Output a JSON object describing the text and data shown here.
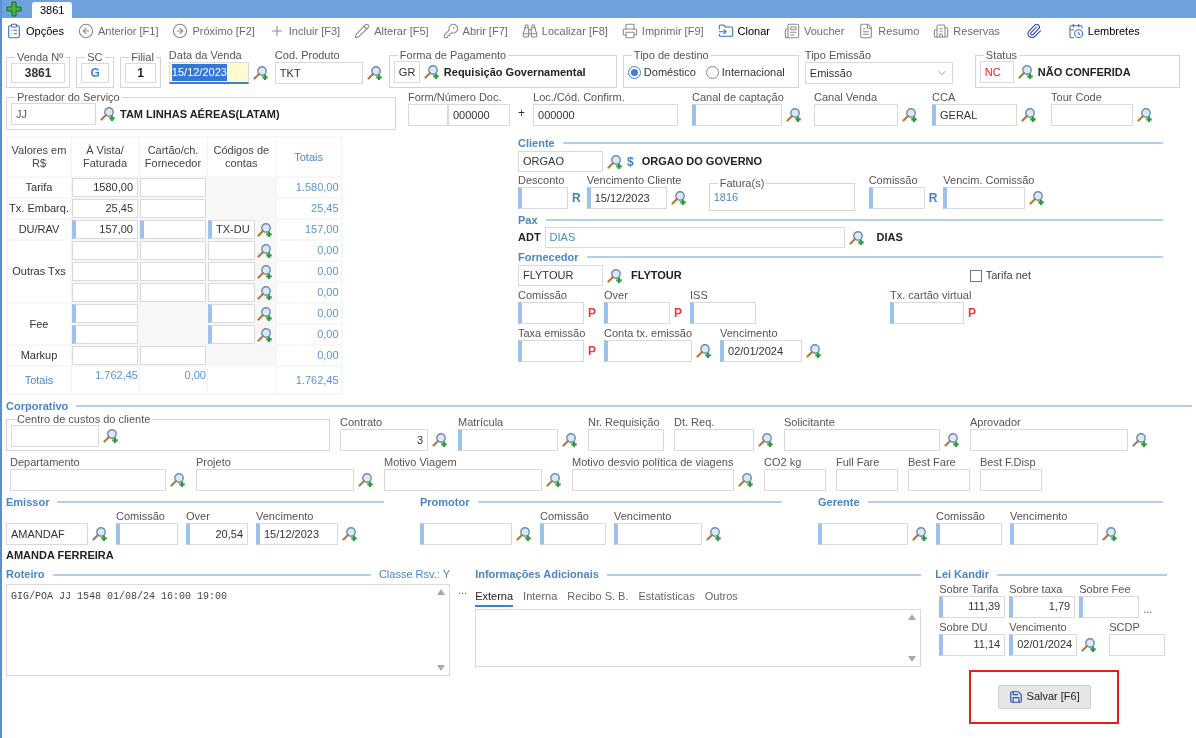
{
  "tab_bar": {
    "tab": "3861"
  },
  "toolbar": [
    {
      "label": "Opções",
      "kind": "button",
      "disabled": false
    },
    {
      "label": "Anterior [F1]",
      "kind": "button",
      "disabled": true
    },
    {
      "label": "Próximo [F2]",
      "kind": "button",
      "disabled": true
    },
    {
      "label": "Incluir [F3]",
      "kind": "button",
      "disabled": true
    },
    {
      "label": "Alterar [F5]",
      "kind": "button",
      "disabled": true
    },
    {
      "label": "Abrir [F7]",
      "kind": "button",
      "disabled": true
    },
    {
      "label": "Localizar [F8]",
      "kind": "button",
      "disabled": true
    },
    {
      "label": "Imprimir [F9]",
      "kind": "button",
      "disabled": true
    },
    {
      "label": "Clonar",
      "kind": "button",
      "disabled": false
    },
    {
      "label": "Voucher",
      "kind": "button",
      "disabled": true
    },
    {
      "label": "Resumo",
      "kind": "button",
      "disabled": true
    },
    {
      "label": "Reservas",
      "kind": "button",
      "disabled": true
    },
    {
      "kind": "icon",
      "disabled": false
    },
    {
      "label": "Lembretes",
      "kind": "button",
      "disabled": false
    }
  ],
  "header": {
    "venda": {
      "label": "Venda Nº",
      "value": "3861"
    },
    "sc": {
      "label": "SC",
      "value": "G"
    },
    "filial": {
      "label": "Filial",
      "value": "1"
    },
    "data_venda": {
      "label": "Data da Venda",
      "value": "15/12/2023",
      "focused": true,
      "marked": false,
      "lookup": true
    },
    "cod_produto": {
      "label": "Cod. Produto",
      "value": "TKT",
      "marked": false,
      "lookup": true
    },
    "forma_pagamento": {
      "label": "Forma de Pagamento",
      "code": "GR",
      "name": "Requisição Governamental"
    },
    "tipo_destino": {
      "label": "Tipo de destino",
      "options": [
        {
          "label": "Doméstico",
          "selected": true
        },
        {
          "label": "Internacional",
          "selected": false
        }
      ]
    },
    "tipo_emissao": {
      "label": "Tipo Emissão",
      "value": "Emissão"
    },
    "status": {
      "label": "Status",
      "code": "NC",
      "name": "NÃO CONFERIDA"
    },
    "prestador": {
      "label": "Prestador do Serviço",
      "code": "JJ",
      "name": "TAM LINHAS AÉREAS(LATAM)"
    },
    "form_numero": {
      "label": "Form/Número Doc.",
      "fields": [
        {
          "marked": false,
          "lookup": false
        },
        {
          "value": "000000",
          "marked": false,
          "lookup": false
        }
      ],
      "joiner": "+"
    },
    "loc_confirm": {
      "label": "Loc./Cód. Confirm.",
      "value": "000000",
      "marked": false,
      "lookup": false
    },
    "canal_captacao": {
      "label": "Canal de captação",
      "marked": true,
      "lookup": true
    },
    "canal_venda": {
      "label": "Canal Venda",
      "marked": false,
      "lookup": true
    },
    "cca": {
      "label": "CCA",
      "value": "GERAL",
      "marked": true,
      "lookup": true
    },
    "tour_code": {
      "label": "Tour Code",
      "marked": false,
      "lookup": true
    }
  },
  "values_table": {
    "columns": [
      "Valores em R$",
      "À Vista/ Faturada",
      "Cartão/ch. Fornecedor",
      "Códigos de contas"
    ],
    "totals_header": "Totais",
    "groups": [
      {
        "label": "Tarifa",
        "lines": [
          {
            "vista": {
              "value": "1580,00",
              "marked": false
            },
            "cartao": {
              "marked": false
            },
            "total": "1.580,00"
          }
        ]
      },
      {
        "label": "Tx. Embarq.",
        "lines": [
          {
            "vista": {
              "value": "25,45",
              "marked": false
            },
            "cartao": {
              "marked": false
            },
            "total": "25,45"
          }
        ]
      },
      {
        "label": "DU/RAV",
        "lines": [
          {
            "vista": {
              "value": "157,00",
              "marked": true
            },
            "cartao": {
              "marked": true
            },
            "codigo": {
              "value": "TX-DU",
              "marked": true
            },
            "total": "157,00"
          }
        ]
      },
      {
        "label": "Outras Txs",
        "lines": [
          {
            "vista": {
              "marked": false
            },
            "cartao": {
              "marked": false
            },
            "codigo": {
              "marked": false
            },
            "total": "0,00"
          },
          {
            "vista": {
              "marked": false
            },
            "cartao": {
              "marked": false
            },
            "codigo": {
              "marked": false
            },
            "total": "0,00"
          },
          {
            "vista": {
              "marked": false
            },
            "cartao": {
              "marked": false
            },
            "codigo": {
              "marked": false
            },
            "total": "0,00"
          }
        ]
      },
      {
        "label": "Fee",
        "lines": [
          {
            "vista": {
              "marked": true
            },
            "codigo": {
              "marked": true
            },
            "total": "0,00"
          },
          {
            "vista": {
              "marked": true
            },
            "codigo": {
              "marked": true
            },
            "total": "0,00"
          }
        ]
      },
      {
        "label": "Markup",
        "lines": [
          {
            "vista": {
              "marked": false
            },
            "cartao": {
              "marked": false
            },
            "total": "0,00"
          }
        ]
      }
    ],
    "totals": {
      "label": "Totais",
      "vista": "1.762,45",
      "cartao": "0,00",
      "total": "1.762,45"
    }
  },
  "cliente": {
    "title": "Cliente",
    "code": "ORGAO",
    "symbol": "$",
    "name": "ORGAO DO GOVERNO",
    "desconto": {
      "label": "Desconto",
      "marked": true,
      "lookup": false,
      "suffix": "R",
      "color": "#3b82d6"
    },
    "vencimento": {
      "label": "Vencimento Cliente",
      "value": "15/12/2023",
      "marked": true,
      "lookup": true
    },
    "faturas": {
      "label": "Fatura(s)",
      "value": "1816"
    },
    "comissao": {
      "label": "Comissão",
      "marked": true,
      "lookup": false,
      "suffix": "R",
      "color": "#3b82d6"
    },
    "vencim_comissao": {
      "label": "Vencim. Comissão",
      "marked": true,
      "lookup": true
    }
  },
  "pax": {
    "title": "Pax",
    "type": "ADT",
    "value": "DIAS",
    "name": "DIAS"
  },
  "fornecedor": {
    "title": "Fornecedor",
    "code": "FLYTOUR",
    "name": "FLYTOUR",
    "tarifa_net": {
      "label": "Tarifa net",
      "checked": false
    },
    "comissao": {
      "label": "Comissão",
      "marked": true,
      "lookup": false,
      "suffix": "P",
      "color": "#f03a3a"
    },
    "over": {
      "label": "Over",
      "marked": true,
      "lookup": false,
      "suffix": "P",
      "color": "#f03a3a"
    },
    "iss": {
      "label": "ISS",
      "marked": true,
      "lookup": false
    },
    "tx_cartao": {
      "label": "Tx. cartão virtual",
      "marked": true,
      "lookup": false,
      "suffix": "P",
      "color": "#f03a3a"
    },
    "taxa_emissao": {
      "label": "Taxa emissão",
      "marked": true,
      "lookup": false,
      "suffix": "P",
      "color": "#f03a3a"
    },
    "conta_tx": {
      "label": "Conta tx. emissão",
      "marked": true,
      "lookup": true
    },
    "vencimento": {
      "label": "Vencimento",
      "value": "02/01/2024",
      "marked": true,
      "lookup": true
    }
  },
  "corporativo": {
    "title": "Corporativo",
    "centro_custos": {
      "label": "Centro de custos do cliente",
      "marked": false,
      "lookup": true
    },
    "contrato": {
      "label": "Contrato",
      "value": "3",
      "marked": false,
      "lookup": true
    },
    "matricula": {
      "label": "Matrícula",
      "marked": true,
      "lookup": true
    },
    "nr_requisicao": {
      "label": "Nr. Requisição",
      "marked": false,
      "lookup": false
    },
    "dt_req": {
      "label": "Dt. Req.",
      "marked": false,
      "lookup": true
    },
    "solicitante": {
      "label": "Solicitante",
      "marked": false,
      "lookup": true
    },
    "aprovador": {
      "label": "Aprovador",
      "marked": false,
      "lookup": true
    },
    "departamento": {
      "label": "Departamento",
      "marked": false,
      "lookup": true
    },
    "projeto": {
      "label": "Projeto",
      "marked": false,
      "lookup": true
    },
    "motivo_viagem": {
      "label": "Motivo Viagem",
      "marked": false,
      "lookup": true
    },
    "motivo_desvio": {
      "label": "Motivo desvio política de viagens",
      "marked": false,
      "lookup": true
    },
    "co2": {
      "label": "CO2 kg",
      "marked": false,
      "lookup": false
    },
    "full_fare": {
      "label": "Full Fare",
      "marked": false,
      "lookup": false
    },
    "best_fare": {
      "label": "Best Fare",
      "marked": false,
      "lookup": false
    },
    "best_fdisp": {
      "label": "Best F.Disp",
      "marked": false,
      "lookup": false
    }
  },
  "emissor": {
    "title": "Emissor",
    "code": {
      "value": "AMANDAF",
      "marked": false,
      "lookup": true
    },
    "comissao": {
      "label": "Comissão",
      "marked": true,
      "lookup": false
    },
    "over": {
      "label": "Over",
      "value": "20,54",
      "marked": true,
      "lookup": false
    },
    "vencimento": {
      "label": "Vencimento",
      "value": "15/12/2023",
      "marked": true,
      "lookup": true
    },
    "name": "AMANDA FERREIRA"
  },
  "promotor": {
    "title": "Promotor",
    "code": {
      "marked": true,
      "lookup": true
    },
    "comissao": {
      "label": "Comissão",
      "marked": true,
      "lookup": false
    },
    "vencimento": {
      "label": "Vencimento",
      "marked": true,
      "lookup": true
    }
  },
  "gerente": {
    "title": "Gerente",
    "code": {
      "marked": true,
      "lookup": true
    },
    "comissao": {
      "label": "Comissão",
      "marked": true,
      "lookup": false
    },
    "vencimento": {
      "label": "Vencimento",
      "marked": true,
      "lookup": true
    }
  },
  "roteiro": {
    "title": "Roteiro",
    "classe": "Classe Rsv.: Y",
    "text": "GIG/POA JJ 1548 01/08/24 16:00 19:00",
    "more": "..."
  },
  "info": {
    "title": "Informações Adicionais",
    "tabs": [
      {
        "label": "Externa",
        "selected": true
      },
      {
        "label": "Interna",
        "selected": false
      },
      {
        "label": "Recibo S. B.",
        "selected": false
      },
      {
        "label": "Estatísticas",
        "selected": false
      },
      {
        "label": "Outros",
        "selected": false
      }
    ]
  },
  "lei_kandir": {
    "title": "Lei Kandir",
    "sobre_tarifa": {
      "label": "Sobre Tarifa",
      "value": "111,39",
      "marked": true,
      "lookup": false
    },
    "sobre_taxa": {
      "label": "Sobre taxa",
      "value": "1,79",
      "marked": true,
      "lookup": false
    },
    "sobre_fee": {
      "label": "Sobre Fee",
      "marked": true,
      "lookup": false
    },
    "more": "...",
    "sobre_du": {
      "label": "Sobre DU",
      "value": "11,14",
      "marked": true,
      "lookup": false
    },
    "vencimento": {
      "label": "Vencimento",
      "value": "02/01/2024",
      "marked": true,
      "lookup": true
    },
    "scdp": {
      "label": "SCDP",
      "marked": false,
      "lookup": false
    }
  },
  "save_button": {
    "label": "Salvar [F6]",
    "highlighted": true
  }
}
